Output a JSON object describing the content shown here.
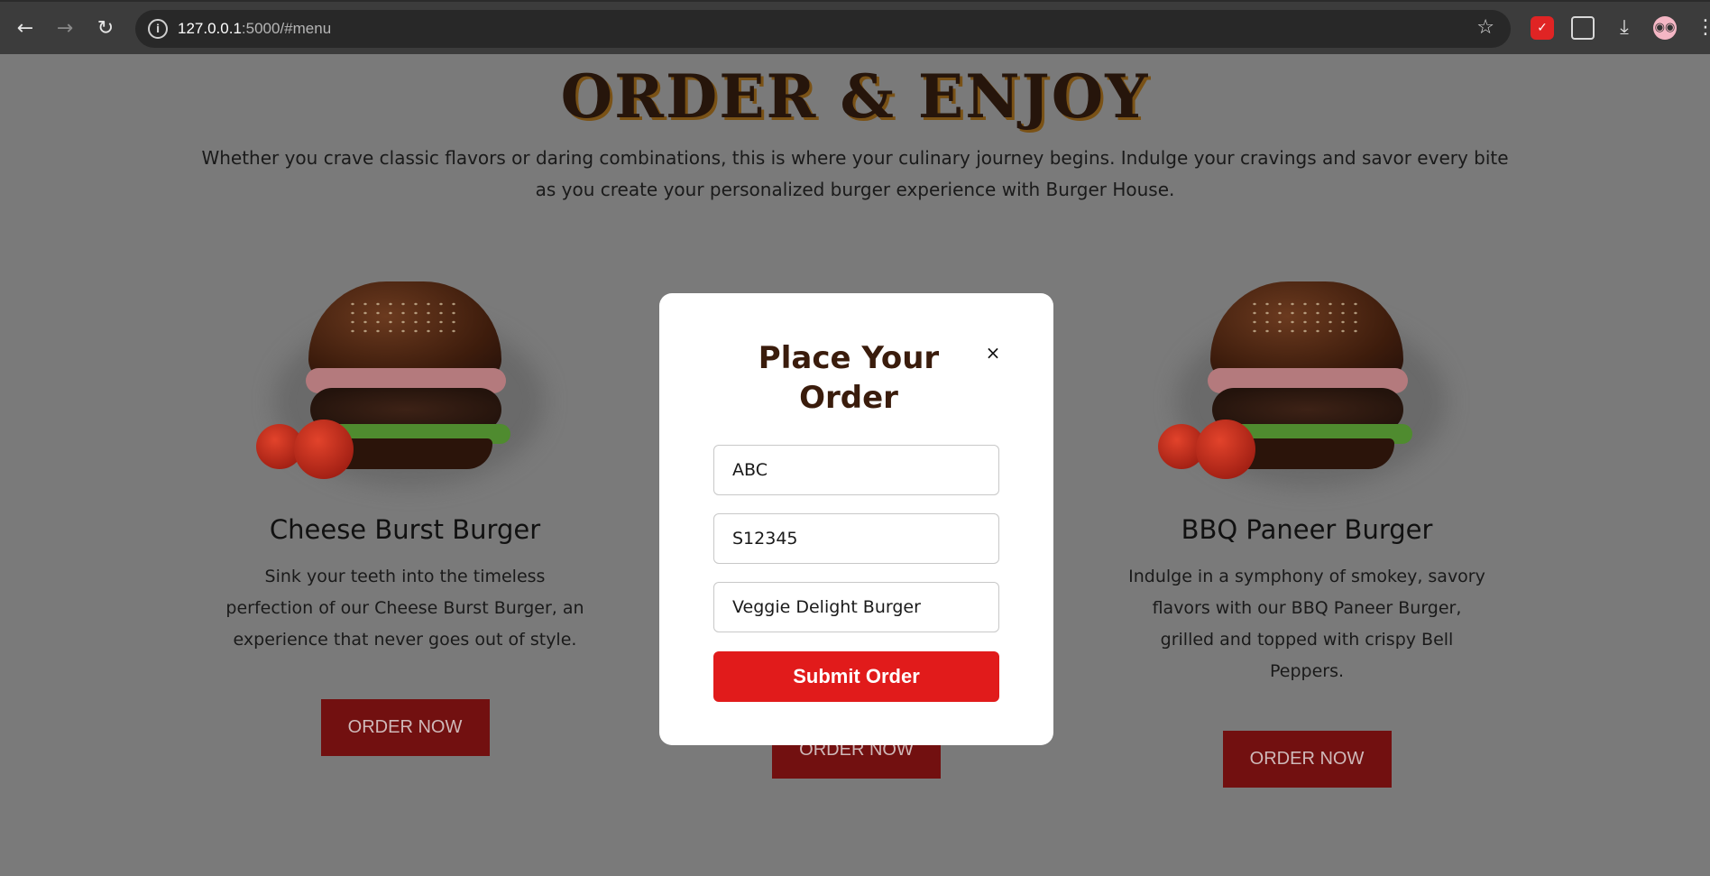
{
  "browser": {
    "url_host": "127.0.0.1",
    "url_path": ":5000/#menu",
    "back_icon": "arrow-left",
    "forward_icon": "arrow-right",
    "reload_icon": "reload",
    "star_icon": "star"
  },
  "hero": {
    "title": "ORDER & ENJOY",
    "description": "Whether you crave classic flavors or daring combinations, this is where your culinary journey begins. Indulge your cravings and savor every bite as you create your personalized burger experience with Burger House."
  },
  "cards": [
    {
      "title": "Cheese Burst Burger",
      "description": "Sink your teeth into the timeless perfection of our Cheese Burst Burger, an experience that never goes out of style.",
      "button": "ORDER NOW"
    },
    {
      "button": "ORDER NOW"
    },
    {
      "title": "BBQ Paneer Burger",
      "description": "Indulge in a symphony of smokey, savory flavors with our BBQ Paneer Burger, grilled and topped with crispy Bell Peppers.",
      "button": "ORDER NOW"
    }
  ],
  "modal": {
    "title": "Place Your Order",
    "close": "×",
    "fields": [
      {
        "value": "ABC"
      },
      {
        "value": "S12345"
      },
      {
        "value": "Veggie Delight Burger"
      }
    ],
    "submit": "Submit Order"
  },
  "colors": {
    "accent_red": "#e11b1b",
    "dark_red": "#721010",
    "title_brown": "#3a1c0c"
  }
}
